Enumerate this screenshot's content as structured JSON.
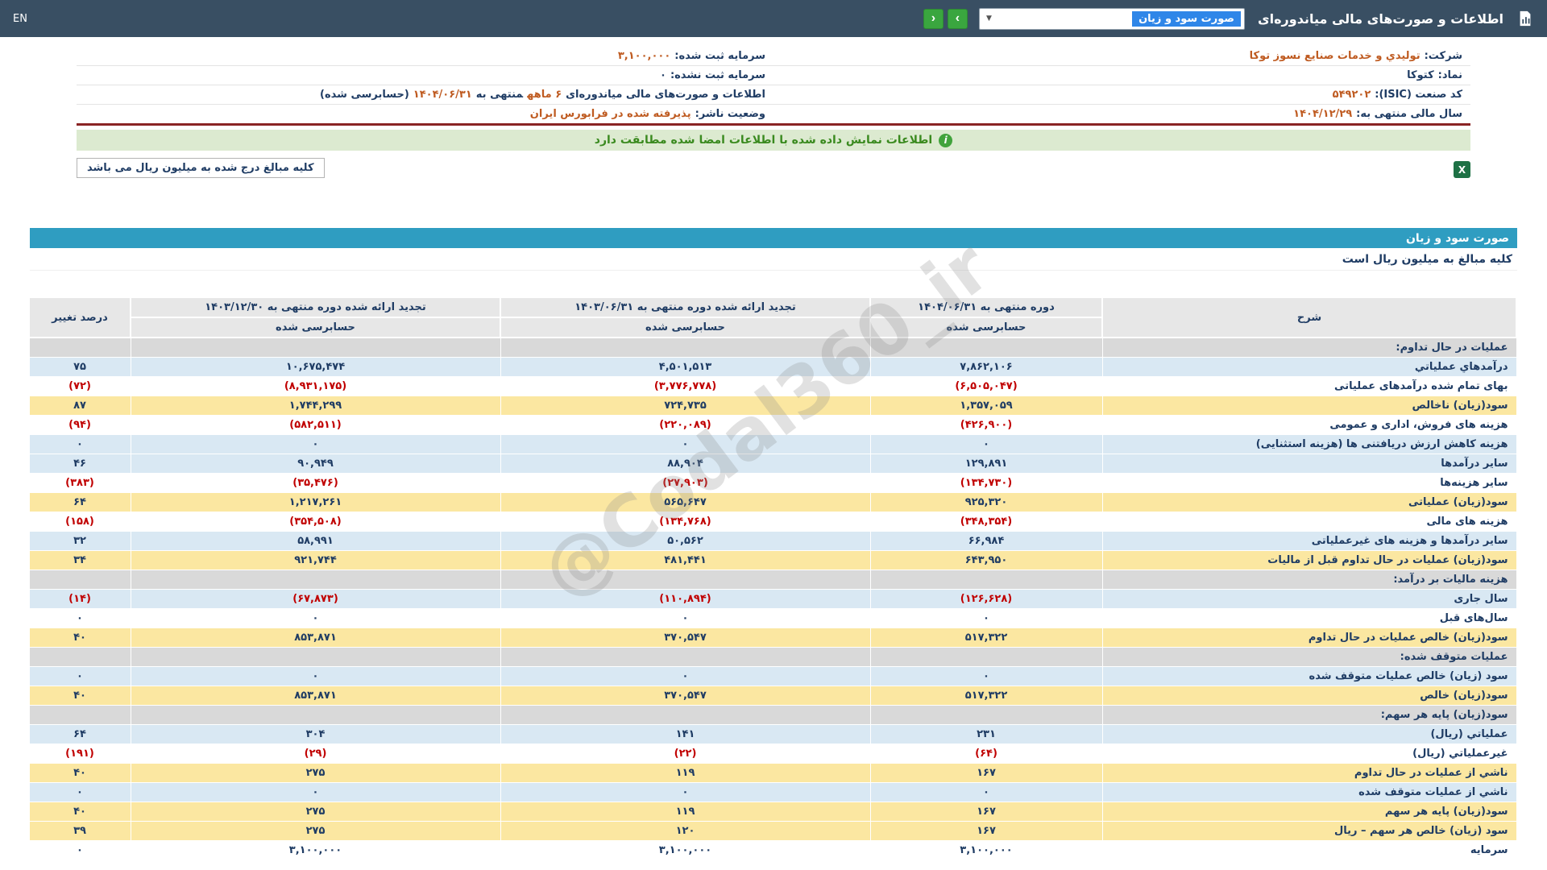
{
  "topbar": {
    "title": "اطلاعات و صورت‌های مالی میاندوره‌ای",
    "statement_select_value": "صورت سود و زیان",
    "en_label": "EN"
  },
  "icons": {
    "dropdown_caret": "▼",
    "nav_prev": "‹",
    "nav_next": "›",
    "info": "i",
    "excel": "X"
  },
  "info": {
    "rows": [
      {
        "right": [
          {
            "t": "شرکت:",
            "c": "label"
          },
          {
            "t": "تولیدي و خدمات صنایع نسوز توکا",
            "c": "accent"
          }
        ],
        "left": [
          {
            "t": "سرمایه ثبت شده:",
            "c": "label"
          },
          {
            "t": "۳,۱۰۰,۰۰۰",
            "c": "accent"
          }
        ]
      },
      {
        "right": [
          {
            "t": "نماد:",
            "c": "label"
          },
          {
            "t": "کتوکا",
            "c": "plain"
          }
        ],
        "left": [
          {
            "t": "سرمایه ثبت نشده:",
            "c": "label"
          },
          {
            "t": "۰",
            "c": "plain"
          }
        ]
      },
      {
        "right": [
          {
            "t": "کد صنعت (ISIC):",
            "c": "label"
          },
          {
            "t": "۵۴۹۲۰۲",
            "c": "accent"
          }
        ],
        "left": [
          {
            "t": "اطلاعات و صورت‌های مالی میاندوره‌ای",
            "c": "label"
          },
          {
            "t": "۶ ماهه",
            "c": "accent"
          },
          {
            "t": "منتهی به",
            "c": "label"
          },
          {
            "t": "۱۴۰۴/۰۶/۳۱",
            "c": "accent"
          },
          {
            "t": "(حسابرسی شده)",
            "c": "label"
          }
        ]
      },
      {
        "right": [
          {
            "t": "سال مالی منتهی به:",
            "c": "label"
          },
          {
            "t": "۱۴۰۴/۱۲/۲۹",
            "c": "accent"
          }
        ],
        "left": [
          {
            "t": "وضعیت ناشر:",
            "c": "label"
          },
          {
            "t": "پذیرفته شده در فرابورس ایران",
            "c": "accent"
          }
        ]
      }
    ],
    "banner_text": "اطلاعات نمایش داده شده با اطلاعات امضا شده مطابقت دارد",
    "unit_note": "کلیه مبالغ درج شده به میلیون ریال می باشد"
  },
  "watermark": "@Codal360_ir",
  "statement": {
    "title": "صورت سود و زیان",
    "subtitle": "کلیه مبالغ به میلیون ریال است",
    "columns": {
      "desc": "شرح",
      "period_current": "دوره منتهی به ۱۴۰۴/۰۶/۳۱",
      "period_restated_mid": "تجدید ارائه شده دوره منتهی به ۱۴۰۳/۰۶/۳۱",
      "period_restated_year": "تجدید ارائه شده دوره منتهی به ۱۴۰۳/۱۲/۳۰",
      "audited": "حسابرسی شده",
      "change": "درصد تغییر"
    },
    "rows": [
      {
        "label": "عملیات در حال تداوم:",
        "variant": "section"
      },
      {
        "label": "درآمدهاي عملياتي",
        "v1": "۷,۸۶۲,۱۰۶",
        "v2": "۴,۵۰۱,۵۱۳",
        "v3": "۱۰,۶۷۵,۴۷۴",
        "chg": "۷۵",
        "variant": "blue"
      },
      {
        "label": "بهای تمام شده درآمدهای عملیاتی",
        "v1": "(۶,۵۰۵,۰۴۷)",
        "v2": "(۳,۷۷۶,۷۷۸)",
        "v3": "(۸,۹۳۱,۱۷۵)",
        "chg": "(۷۲)",
        "variant": "white"
      },
      {
        "label": "سود(زیان) ناخالص",
        "v1": "۱,۳۵۷,۰۵۹",
        "v2": "۷۲۴,۷۳۵",
        "v3": "۱,۷۴۴,۲۹۹",
        "chg": "۸۷",
        "variant": "yellow"
      },
      {
        "label": "هزینه های فروش، اداری و عمومی",
        "v1": "(۴۲۶,۹۰۰)",
        "v2": "(۲۲۰,۰۸۹)",
        "v3": "(۵۸۲,۵۱۱)",
        "chg": "(۹۴)",
        "variant": "white"
      },
      {
        "label": "هزینه کاهش ارزش دریافتنی ها (هزینه استثنایی)",
        "v1": "۰",
        "v2": "۰",
        "v3": "۰",
        "chg": "۰",
        "variant": "blue"
      },
      {
        "label": "سایر درآمدها",
        "v1": "۱۲۹,۸۹۱",
        "v2": "۸۸,۹۰۴",
        "v3": "۹۰,۹۴۹",
        "chg": "۴۶",
        "variant": "blue"
      },
      {
        "label": "سایر هزینه‌ها",
        "v1": "(۱۳۴,۷۳۰)",
        "v2": "(۲۷,۹۰۳)",
        "v3": "(۳۵,۴۷۶)",
        "chg": "(۳۸۳)",
        "variant": "white"
      },
      {
        "label": "سود(زیان) عملیاتی",
        "v1": "۹۲۵,۳۲۰",
        "v2": "۵۶۵,۶۴۷",
        "v3": "۱,۲۱۷,۲۶۱",
        "chg": "۶۴",
        "variant": "yellow"
      },
      {
        "label": "هزینه های مالی",
        "v1": "(۳۴۸,۳۵۴)",
        "v2": "(۱۳۴,۷۶۸)",
        "v3": "(۳۵۴,۵۰۸)",
        "chg": "(۱۵۸)",
        "variant": "white"
      },
      {
        "label": "سایر درآمدها و هزینه های غیرعملیاتی",
        "v1": "۶۶,۹۸۴",
        "v2": "۵۰,۵۶۲",
        "v3": "۵۸,۹۹۱",
        "chg": "۳۲",
        "variant": "blue"
      },
      {
        "label": "سود(زیان) عملیات در حال تداوم قبل از مالیات",
        "v1": "۶۴۳,۹۵۰",
        "v2": "۴۸۱,۴۴۱",
        "v3": "۹۲۱,۷۴۴",
        "chg": "۳۴",
        "variant": "yellow"
      },
      {
        "label": "هزینه مالیات بر درآمد:",
        "variant": "section"
      },
      {
        "label": "سال جاری",
        "v1": "(۱۲۶,۶۲۸)",
        "v2": "(۱۱۰,۸۹۴)",
        "v3": "(۶۷,۸۷۳)",
        "chg": "(۱۴)",
        "variant": "blue"
      },
      {
        "label": "سال‌های قبل",
        "v1": "۰",
        "v2": "۰",
        "v3": "۰",
        "chg": "۰",
        "variant": "white"
      },
      {
        "label": "سود(زیان) خالص عملیات در حال تداوم",
        "v1": "۵۱۷,۳۲۲",
        "v2": "۳۷۰,۵۴۷",
        "v3": "۸۵۳,۸۷۱",
        "chg": "۴۰",
        "variant": "yellow"
      },
      {
        "label": "عملیات متوقف شده:",
        "variant": "section"
      },
      {
        "label": "سود (زیان) خالص عملیات متوقف شده",
        "v1": "۰",
        "v2": "۰",
        "v3": "۰",
        "chg": "۰",
        "variant": "blue"
      },
      {
        "label": "سود(زیان) خالص",
        "v1": "۵۱۷,۳۲۲",
        "v2": "۳۷۰,۵۴۷",
        "v3": "۸۵۳,۸۷۱",
        "chg": "۴۰",
        "variant": "yellow"
      },
      {
        "label": "سود(زیان) پایه هر سهم:",
        "variant": "section"
      },
      {
        "label": "عملیاتي (ریال)",
        "v1": "۲۳۱",
        "v2": "۱۴۱",
        "v3": "۳۰۴",
        "chg": "۶۴",
        "variant": "blue"
      },
      {
        "label": "غیرعملیاتي (ریال)",
        "v1": "(۶۴)",
        "v2": "(۲۲)",
        "v3": "(۲۹)",
        "chg": "(۱۹۱)",
        "variant": "white"
      },
      {
        "label": "ناشي از عملیات در حال تداوم",
        "v1": "۱۶۷",
        "v2": "۱۱۹",
        "v3": "۲۷۵",
        "chg": "۴۰",
        "variant": "yellow"
      },
      {
        "label": "ناشي از عملیات متوقف شده",
        "v1": "۰",
        "v2": "۰",
        "v3": "۰",
        "chg": "۰",
        "variant": "blue"
      },
      {
        "label": "سود(زیان) پایه هر سهم",
        "v1": "۱۶۷",
        "v2": "۱۱۹",
        "v3": "۲۷۵",
        "chg": "۴۰",
        "variant": "yellow"
      },
      {
        "label": "سود (زیان) خالص هر سهم – ریال",
        "v1": "۱۶۷",
        "v2": "۱۲۰",
        "v3": "۲۷۵",
        "chg": "۳۹",
        "variant": "yellow"
      },
      {
        "label": "سرمایه",
        "v1": "۳,۱۰۰,۰۰۰",
        "v2": "۳,۱۰۰,۰۰۰",
        "v3": "۳,۱۰۰,۰۰۰",
        "chg": "۰",
        "variant": "white"
      }
    ]
  },
  "colors": {
    "topbar": "#394f63",
    "title_bar_blue": "#2f9dc1",
    "accent_orange": "#bf5b21",
    "navy_text": "#1f3c64",
    "negative_red": "#c00000",
    "row_blue": "#d9e8f3",
    "row_yellow": "#fbe7a1",
    "section_gray": "#d9d9d9",
    "nav_green": "#3aa63f",
    "banner_green_bg": "#dcead0",
    "maroon_divider": "#8a2424"
  }
}
